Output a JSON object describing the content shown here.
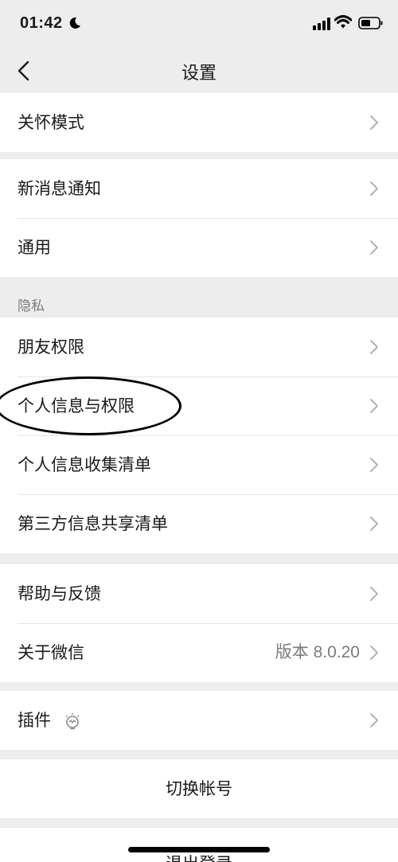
{
  "status_bar": {
    "time": "01:42"
  },
  "nav": {
    "title": "设置"
  },
  "groups": {
    "care": {
      "items": [
        {
          "label": "关怀模式"
        }
      ]
    },
    "general": {
      "items": [
        {
          "label": "新消息通知"
        },
        {
          "label": "通用"
        }
      ]
    },
    "privacy": {
      "section_label": "隐私",
      "items": [
        {
          "label": "朋友权限"
        },
        {
          "label": "个人信息与权限"
        },
        {
          "label": "个人信息收集清单"
        },
        {
          "label": "第三方信息共享清单"
        }
      ]
    },
    "about": {
      "items": [
        {
          "label": "帮助与反馈"
        },
        {
          "label": "关于微信",
          "value": "版本 8.0.20"
        }
      ]
    },
    "plugins": {
      "items": [
        {
          "label": "插件",
          "icon": "lightbulb-icon"
        }
      ]
    }
  },
  "actions": {
    "switch_account": "切换帐号",
    "logout": "退出登录"
  },
  "colors": {
    "background": "#ededed",
    "card": "#ffffff",
    "secondary_text": "#7b7b7b"
  }
}
